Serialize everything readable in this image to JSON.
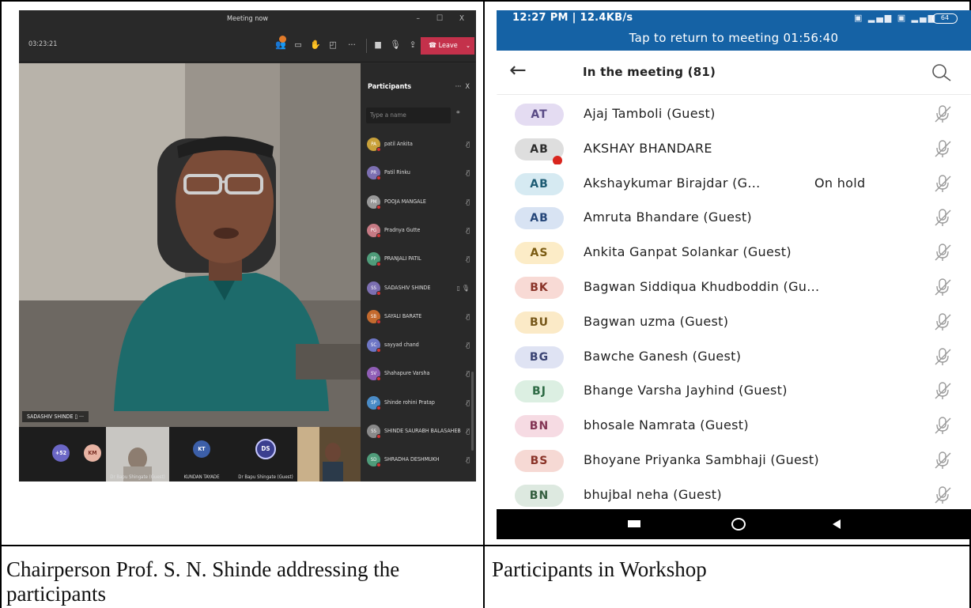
{
  "teams": {
    "title": "Meeting now",
    "window_controls": "– ☐ X",
    "timer": "03:23:21",
    "leave_label": "Leave",
    "speaker_name": "SADASHIV SHINDE",
    "panel_title": "Participants",
    "panel_more": "···",
    "panel_close": "X",
    "search_placeholder": "Type a name",
    "participants": [
      {
        "initials": "PA",
        "name": "patil Ankita",
        "color": "#c9a13a"
      },
      {
        "initials": "PR",
        "name": "Patil Rinku",
        "color": "#7c6fb1"
      },
      {
        "initials": "PM",
        "name": "POOJA MANGALE",
        "color": "#999999"
      },
      {
        "initials": "PG",
        "name": "Pradnya Gutte",
        "color": "#c67a84"
      },
      {
        "initials": "PP",
        "name": "PRANJALI PATIL",
        "color": "#4f9c7a"
      },
      {
        "initials": "SS",
        "name": "SADASHIV SHINDE",
        "color": "#7c6fb1"
      },
      {
        "initials": "SB",
        "name": "SAYALI BARATE",
        "color": "#c46a2e"
      },
      {
        "initials": "SC",
        "name": "sayyad chand",
        "color": "#6e76c5"
      },
      {
        "initials": "SV",
        "name": "Shahapure Varsha",
        "color": "#8f5db5"
      },
      {
        "initials": "SP",
        "name": "Shinde rohini Pratap",
        "color": "#4a8bc6"
      },
      {
        "initials": "SS",
        "name": "SHINDE SAURABH BALASAHEB",
        "color": "#8a8a8a"
      },
      {
        "initials": "SD",
        "name": "SHRADHA DESHMUKH",
        "color": "#4f9c7a"
      }
    ],
    "strip": {
      "more_count": "+52",
      "km": "KM",
      "kt": "KT",
      "ds": "DS",
      "label_1": "Dr Bapu Shingate (Guest)",
      "label_2": "KUNDAN TAYADE",
      "label_3": "Dr Bapu Shingate (Guest)"
    }
  },
  "phone": {
    "status_time": "12:27 PM | 12.4KB/s",
    "battery": "64",
    "banner": "Tap to return to meeting 01:56:40",
    "header_title": "In the meeting (81)",
    "participants": [
      {
        "initials": "AT",
        "name": "Ajaj Tamboli (Guest)",
        "bg": "#e4dcf2",
        "fg": "#5a4b86"
      },
      {
        "initials": "AB",
        "name": "AKSHAY BHANDARE",
        "bg": "#dedede",
        "fg": "#2e2e2e"
      },
      {
        "initials": "AB",
        "name": "Akshaykumar Birajdar (G...",
        "bg": "#d6eaf2",
        "fg": "#1d5b73",
        "status": "On hold"
      },
      {
        "initials": "AB",
        "name": "Amruta Bhandare (Guest)",
        "bg": "#d8e3f3",
        "fg": "#26477a"
      },
      {
        "initials": "AS",
        "name": "Ankita Ganpat Solankar  (Guest)",
        "bg": "#fcecc7",
        "fg": "#7a5b12"
      },
      {
        "initials": "BK",
        "name": "Bagwan Siddiqua Khudboddin (Gu...",
        "bg": "#f8dad5",
        "fg": "#8a3328"
      },
      {
        "initials": "BU",
        "name": "Bagwan uzma (Guest)",
        "bg": "#fbeac7",
        "fg": "#76571a"
      },
      {
        "initials": "BG",
        "name": "Bawche Ganesh (Guest)",
        "bg": "#dfe3f3",
        "fg": "#3a4373"
      },
      {
        "initials": "BJ",
        "name": "Bhange Varsha Jayhind  (Guest)",
        "bg": "#dcefe2",
        "fg": "#2d6a44"
      },
      {
        "initials": "BN",
        "name": "bhosale Namrata  (Guest)",
        "bg": "#f6dbe3",
        "fg": "#833454"
      },
      {
        "initials": "BS",
        "name": "Bhoyane Priyanka Sambhaji (Guest)",
        "bg": "#f6d9d4",
        "fg": "#8a3328"
      },
      {
        "initials": "BN",
        "name": "bhujbal neha (Guest)",
        "bg": "#dde9e0",
        "fg": "#345e3f"
      }
    ]
  },
  "captions": {
    "left": "Chairperson Prof. S. N. Shinde addressing the participants",
    "right": "Participants in Workshop"
  }
}
